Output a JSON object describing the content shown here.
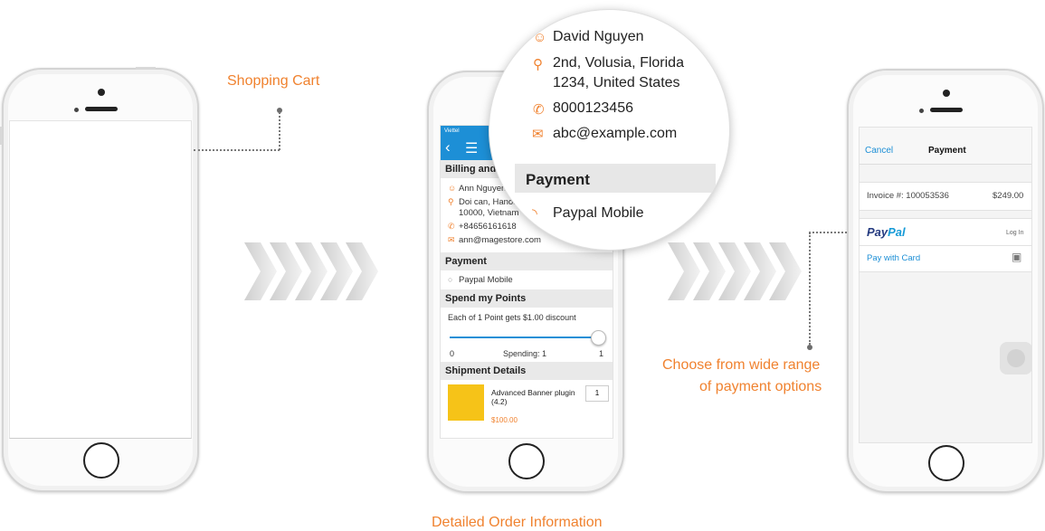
{
  "captions": {
    "shopping_cart": "Shopping Cart",
    "detailed_order": "Detailed Order Information",
    "payment_options_line1": "Choose from wide range",
    "payment_options_line2": "of payment options"
  },
  "colors": {
    "accent": "#f0822f",
    "ios_blue": "#1d8fd6",
    "paypal_dark": "#253b80",
    "paypal_light": "#179bd7"
  },
  "order_screen": {
    "carrier": "Viettel",
    "billing_title": "Billing and S",
    "name": "Ann Nguyen",
    "address_line1": "Doi can, Hanoi",
    "address_line2": "10000, Vietnam",
    "phone": "+84656161618",
    "email": "ann@magestore.com",
    "payment_title": "Payment",
    "payment_option": "Paypal Mobile",
    "points_title": "Spend my Points",
    "points_desc": "Each of 1 Point gets $1.00 discount",
    "slider_min": "0",
    "slider_max": "1",
    "slider_value_text": "Spending: 1",
    "slider_level": 1.0,
    "shipment_title": "Shipment Details",
    "product_name": "Advanced Banner plugin (4.2)",
    "product_qty": "1",
    "product_price": "$100.00"
  },
  "magnifier": {
    "name": "David Nguyen",
    "address_line1": "2nd, Volusia, Florida",
    "address_line2": "1234, United States",
    "phone": "8000123456",
    "email": "abc@example.com",
    "payment_title": "Payment",
    "payment_option": "Paypal Mobile"
  },
  "paypal_screen": {
    "cancel": "Cancel",
    "title": "Payment",
    "invoice_label": "Invoice #: 100053536",
    "amount": "$249.00",
    "paypal_pay": "Pay",
    "paypal_pal": "Pal",
    "login": "Log In",
    "pay_with_card": "Pay with Card"
  }
}
